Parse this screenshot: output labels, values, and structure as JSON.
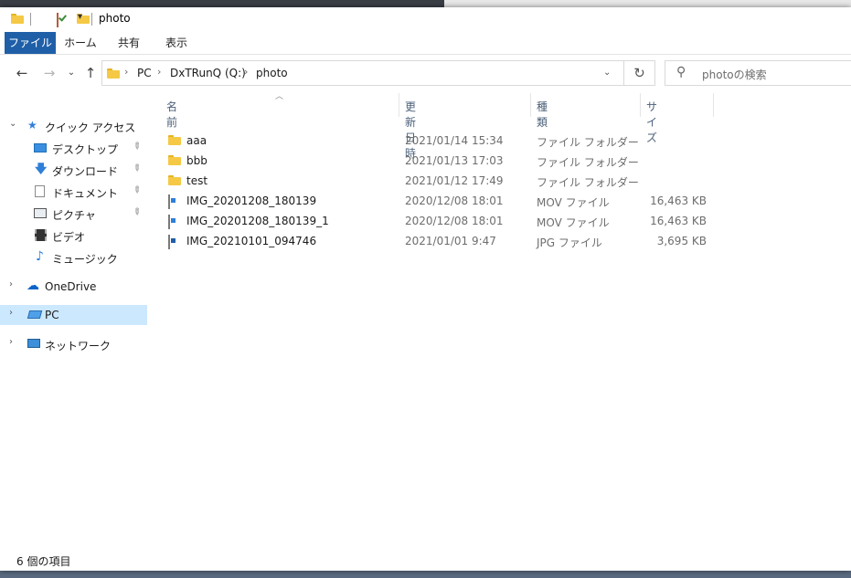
{
  "window": {
    "title": "photo"
  },
  "ribbon": {
    "tabs": [
      {
        "label": "ファイル"
      },
      {
        "label": "ホーム"
      },
      {
        "label": "共有"
      },
      {
        "label": "表示"
      }
    ]
  },
  "address": {
    "crumbs": [
      "PC",
      "DxTRunQ (Q:)",
      "photo"
    ]
  },
  "search": {
    "placeholder": "photoの検索"
  },
  "nav": {
    "quick_access": "クイック アクセス",
    "items": [
      {
        "label": "デスクトップ",
        "icon": "desktop-icon",
        "pinned": true
      },
      {
        "label": "ダウンロード",
        "icon": "download-icon",
        "pinned": true
      },
      {
        "label": "ドキュメント",
        "icon": "document-icon",
        "pinned": true
      },
      {
        "label": "ピクチャ",
        "icon": "picture-icon",
        "pinned": true
      },
      {
        "label": "ビデオ",
        "icon": "video-icon",
        "pinned": false
      },
      {
        "label": "ミュージック",
        "icon": "music-icon",
        "pinned": false
      }
    ],
    "onedrive": "OneDrive",
    "pc": "PC",
    "network": "ネットワーク"
  },
  "columns": {
    "name": "名前",
    "date": "更新日時",
    "type": "種類",
    "size": "サイズ"
  },
  "files": [
    {
      "name": "aaa",
      "date": "2021/01/14 15:34",
      "type": "ファイル フォルダー",
      "size": "",
      "icon": "folder-icon"
    },
    {
      "name": "bbb",
      "date": "2021/01/13 17:03",
      "type": "ファイル フォルダー",
      "size": "",
      "icon": "folder-icon"
    },
    {
      "name": "test",
      "date": "2021/01/12 17:49",
      "type": "ファイル フォルダー",
      "size": "",
      "icon": "folder-icon"
    },
    {
      "name": "IMG_20201208_180139",
      "date": "2020/12/08 18:01",
      "type": "MOV ファイル",
      "size": "16,463 KB",
      "icon": "video-file-icon"
    },
    {
      "name": "IMG_20201208_180139_1",
      "date": "2020/12/08 18:01",
      "type": "MOV ファイル",
      "size": "16,463 KB",
      "icon": "video-file-icon"
    },
    {
      "name": "IMG_20210101_094746",
      "date": "2021/01/01 9:47",
      "type": "JPG ファイル",
      "size": "3,695 KB",
      "icon": "image-file-icon"
    }
  ],
  "status": {
    "count_text": "6 個の項目"
  },
  "colors": {
    "accent": "#1f5fa8",
    "selection": "#cce8ff",
    "folder": "#f5c945"
  }
}
